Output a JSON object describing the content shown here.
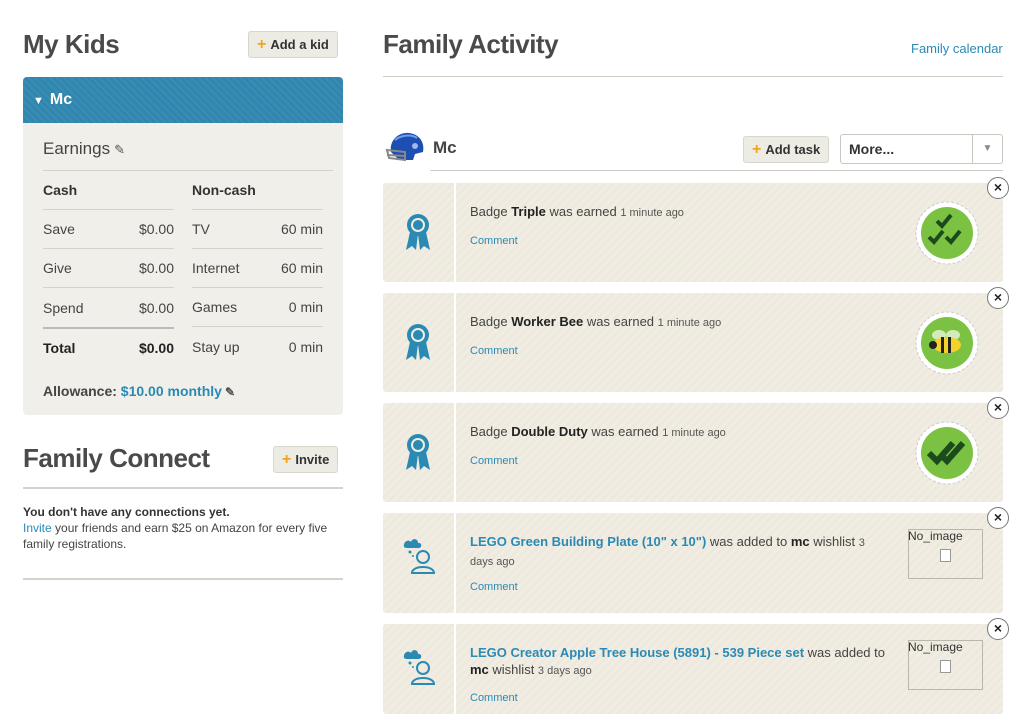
{
  "my_kids": {
    "title": "My Kids",
    "add_kid_label": "Add a kid",
    "kid": {
      "name": "Mc",
      "earnings_label": "Earnings",
      "cash": {
        "header": "Cash",
        "rows": [
          {
            "label": "Save",
            "value": "$0.00"
          },
          {
            "label": "Give",
            "value": "$0.00"
          },
          {
            "label": "Spend",
            "value": "$0.00"
          }
        ],
        "total_label": "Total",
        "total_value": "$0.00"
      },
      "noncash": {
        "header": "Non-cash",
        "rows": [
          {
            "label": "TV",
            "value": "60 min"
          },
          {
            "label": "Internet",
            "value": "60 min"
          },
          {
            "label": "Games",
            "value": "0 min"
          },
          {
            "label": "Stay up",
            "value": "0 min"
          }
        ]
      },
      "allowance_label": "Allowance:",
      "allowance_value": "$10.00 monthly"
    }
  },
  "family_connect": {
    "title": "Family Connect",
    "invite_label": "Invite",
    "no_connections": "You don't have any connections yet.",
    "invite_link": "Invite",
    "invite_text": " your friends and earn $25 on Amazon for every five family registrations."
  },
  "activity": {
    "title": "Family Activity",
    "calendar_link": "Family calendar",
    "kid_name": "Mc",
    "add_task_label": "Add task",
    "more_label": "More...",
    "items": [
      {
        "type": "badge",
        "prefix": "Badge ",
        "name": "Triple",
        "suffix": " was earned ",
        "time": "1 minute ago",
        "comment": "Comment",
        "badge_icon": "triple-check-badge"
      },
      {
        "type": "badge",
        "prefix": "Badge ",
        "name": "Worker Bee",
        "suffix": " was earned ",
        "time": "1 minute ago",
        "comment": "Comment",
        "badge_icon": "bee-badge"
      },
      {
        "type": "badge",
        "prefix": "Badge ",
        "name": "Double Duty",
        "suffix": " was earned ",
        "time": "1 minute ago",
        "comment": "Comment",
        "badge_icon": "double-check-badge"
      },
      {
        "type": "wishlist",
        "item": "LEGO Green Building Plate (10\" x 10\")",
        "middle": " was added to ",
        "kid": "mc",
        "tail": " wishlist ",
        "time": "3 days ago",
        "comment": "Comment",
        "image_label": "No_image"
      },
      {
        "type": "wishlist",
        "item": "LEGO Creator Apple Tree House (5891) - 539 Piece set",
        "middle": " was added to ",
        "kid": "mc",
        "tail": " wishlist ",
        "time": "3 days ago",
        "comment": "Comment",
        "image_label": "No_image"
      }
    ]
  },
  "colors": {
    "accent_blue": "#2f86ae",
    "link_blue": "#2a8ab5",
    "plus_orange": "#f0a51c",
    "badge_green": "#7cc242",
    "card_bg": "#f1ede2"
  }
}
